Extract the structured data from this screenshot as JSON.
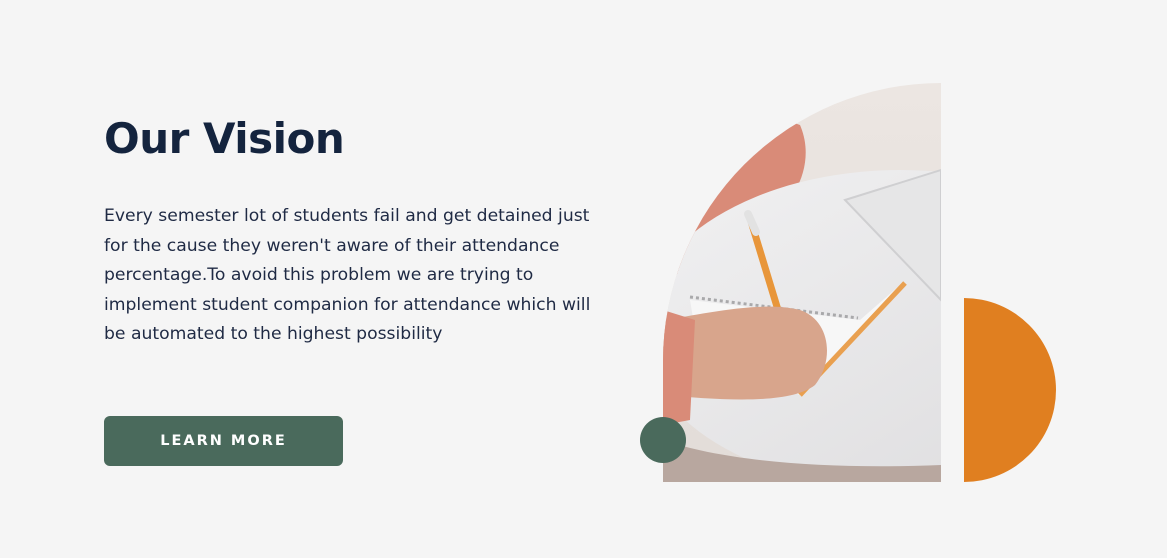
{
  "section": {
    "title": "Our Vision",
    "description": "Every semester lot of students fail and get detained just for the cause they weren't aware of their attendance percentage.To avoid this problem we are trying to implement student companion for attendance which will be automated to the highest possibility",
    "button_label": "LEARN MORE"
  },
  "colors": {
    "background": "#f5f5f5",
    "heading": "#14243e",
    "body_text": "#1f2a44",
    "button": "#4a6a5c",
    "accent_orange": "#e07f20",
    "accent_green_dot": "#4a6a5c"
  },
  "decorations": {
    "photo": "student-writing-in-notebook-photo",
    "orange_shape": "orange-half-circle",
    "green_dot": "green-circle-dot"
  }
}
